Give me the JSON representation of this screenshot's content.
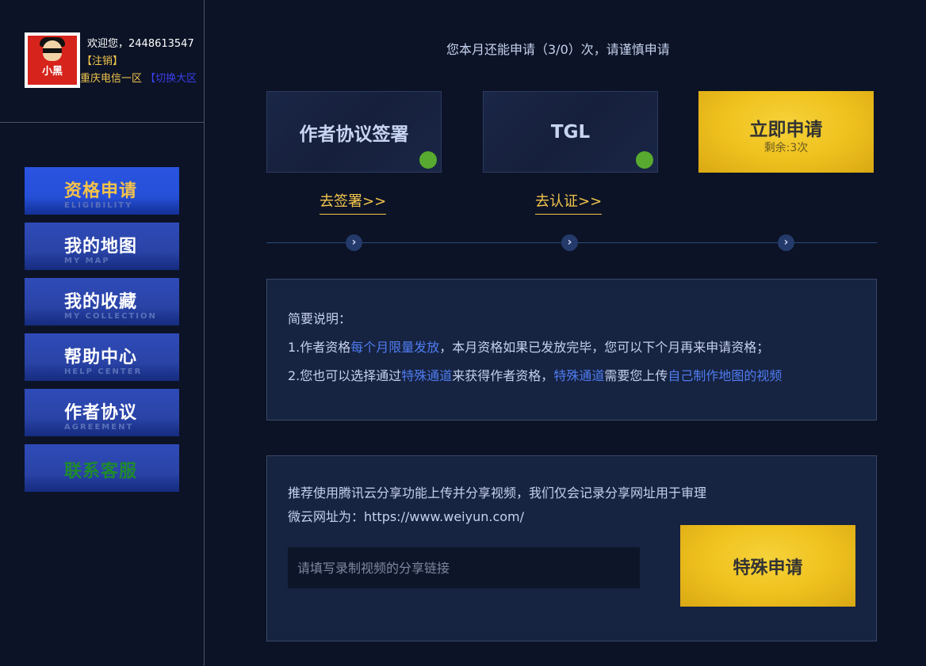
{
  "user": {
    "avatar_text": "小黑",
    "welcome": "欢迎您，2448613547",
    "logout": "【注销】",
    "server": "重庆电信一区",
    "switch_region": "【切换大区"
  },
  "nav": [
    {
      "label": "资格申请",
      "sub": "ELIGIBILITY",
      "active": true
    },
    {
      "label": "我的地图",
      "sub": "MY MAP"
    },
    {
      "label": "我的收藏",
      "sub": "MY COLLECTION"
    },
    {
      "label": "帮助中心",
      "sub": "HELP CENTER"
    },
    {
      "label": "作者协议",
      "sub": "AGREEMENT"
    },
    {
      "label": "联系客服",
      "sub": ""
    }
  ],
  "quota_text": "您本月还能申请（3/0）次，请谨慎申请",
  "steps": [
    {
      "title": "作者协议签署",
      "link": "去签署>>",
      "done": true
    },
    {
      "title": "TGL",
      "link": "去认证>>",
      "done": true
    },
    {
      "title": "立即申请",
      "sub": "剩余:3次"
    }
  ],
  "step_arrow": "›",
  "notice": {
    "heading": "简要说明：",
    "line1_a": "1.作者资格",
    "line1_hl": "每个月限量发放",
    "line1_b": "，本月资格如果已发放完毕，您可以下个月再来申请资格；",
    "line2_a": "2.您也可以选择通过",
    "line2_hl1": "特殊通道",
    "line2_b": "来获得作者资格，",
    "line2_hl2": "特殊通道",
    "line2_c": "需要您上传",
    "line2_hl3": "自己制作地图的视频"
  },
  "special": {
    "line1": "推荐使用腾讯云分享功能上传并分享视频，我们仅会记录分享网址用于审理",
    "line2": "微云网址为：https://www.weiyun.com/",
    "input_placeholder": "请填写录制视频的分享链接",
    "button": "特殊申请"
  },
  "colors": {
    "background": "#0c1326",
    "panel": "#162341",
    "accent_gold": "#f2c54c",
    "highlight_blue": "#4f7cf0",
    "done_green": "#58a92f"
  }
}
